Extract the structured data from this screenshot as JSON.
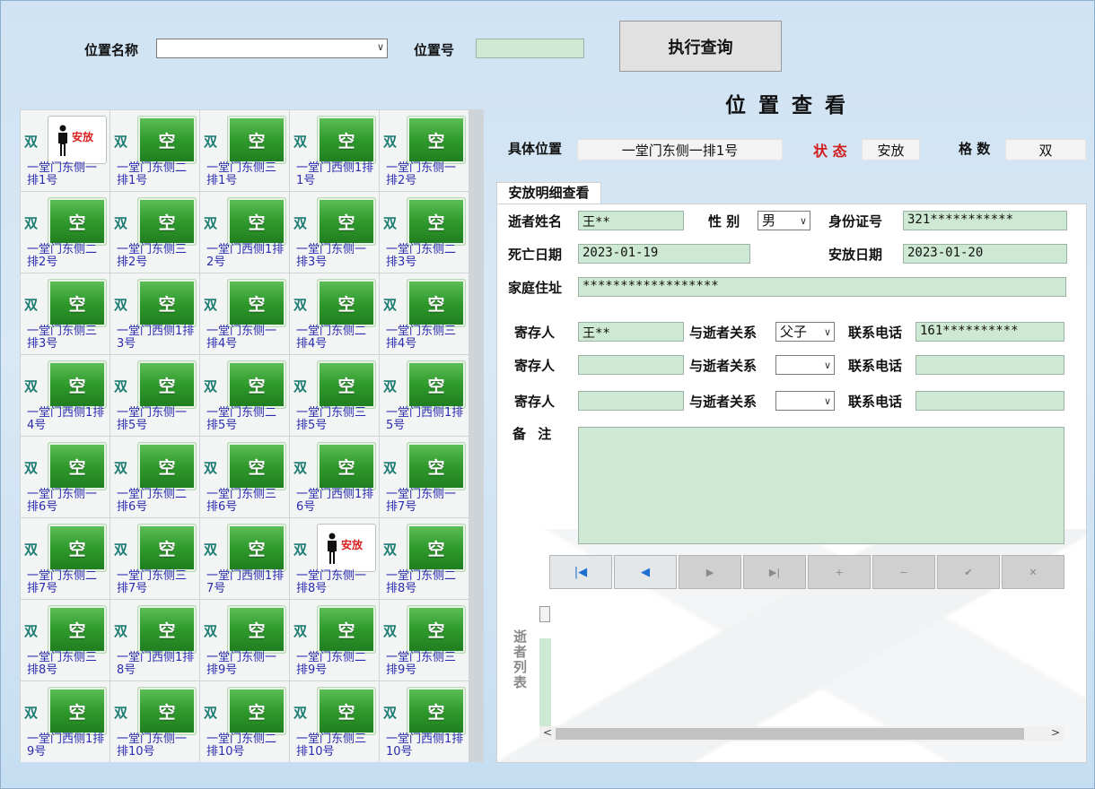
{
  "query": {
    "location_name_label": "位置名称",
    "location_name_value": "",
    "location_no_label": "位置号",
    "location_no_value": "",
    "execute_button": "执行查询"
  },
  "title": "位置查看",
  "detail_header": {
    "location_label": "具体位置",
    "location_value": "一堂门东侧一排1号",
    "status_label": "状 态",
    "status_value": "安放",
    "grid_count_label": "格 数",
    "grid_count_value": "双"
  },
  "tab": {
    "label": "安放明细查看"
  },
  "deceased": {
    "name_label": "逝者姓名",
    "name_value": "王**",
    "gender_label": "性 别",
    "gender_value": "男",
    "id_label": "身份证号",
    "id_value": "321***********",
    "death_label": "死亡日期",
    "death_value": "2023-01-19",
    "placed_label": "安放日期",
    "placed_value": "2023-01-20",
    "address_label": "家庭住址",
    "address_value": "******************"
  },
  "depositors": [
    {
      "label": "寄存人",
      "name": "王**",
      "relation_label": "与逝者关系",
      "relation": "父子",
      "phone_label": "联系电话",
      "phone": "161**********"
    },
    {
      "label": "寄存人",
      "name": "",
      "relation_label": "与逝者关系",
      "relation": "",
      "phone_label": "联系电话",
      "phone": ""
    },
    {
      "label": "寄存人",
      "name": "",
      "relation_label": "与逝者关系",
      "relation": "",
      "phone_label": "联系电话",
      "phone": ""
    }
  ],
  "notes": {
    "label": "备 注",
    "value": ""
  },
  "navigator": [
    "|◀",
    "◀",
    "▶",
    "▶|",
    "+",
    "−",
    "✔",
    "✕"
  ],
  "deceased_list_label": "逝者列表",
  "cells": [
    {
      "type": "双",
      "state": "occupied",
      "state_text": "安放",
      "name": "一堂门东侧一排1号"
    },
    {
      "type": "双",
      "state": "empty",
      "state_text": "空",
      "name": "一堂门东侧二排1号"
    },
    {
      "type": "双",
      "state": "empty",
      "state_text": "空",
      "name": "一堂门东侧三排1号"
    },
    {
      "type": "双",
      "state": "empty",
      "state_text": "空",
      "name": "一堂门西侧1排1号"
    },
    {
      "type": "双",
      "state": "empty",
      "state_text": "空",
      "name": "一堂门东侧一排2号"
    },
    {
      "type": "双",
      "state": "empty",
      "state_text": "空",
      "name": "一堂门东侧二排2号"
    },
    {
      "type": "双",
      "state": "empty",
      "state_text": "空",
      "name": "一堂门东侧三排2号"
    },
    {
      "type": "双",
      "state": "empty",
      "state_text": "空",
      "name": "一堂门西侧1排2号"
    },
    {
      "type": "双",
      "state": "empty",
      "state_text": "空",
      "name": "一堂门东侧一排3号"
    },
    {
      "type": "双",
      "state": "empty",
      "state_text": "空",
      "name": "一堂门东侧二排3号"
    },
    {
      "type": "双",
      "state": "empty",
      "state_text": "空",
      "name": "一堂门东侧三排3号"
    },
    {
      "type": "双",
      "state": "empty",
      "state_text": "空",
      "name": "一堂门西侧1排3号"
    },
    {
      "type": "双",
      "state": "empty",
      "state_text": "空",
      "name": "一堂门东侧一排4号"
    },
    {
      "type": "双",
      "state": "empty",
      "state_text": "空",
      "name": "一堂门东侧二排4号"
    },
    {
      "type": "双",
      "state": "empty",
      "state_text": "空",
      "name": "一堂门东侧三排4号"
    },
    {
      "type": "双",
      "state": "empty",
      "state_text": "空",
      "name": "一堂门西侧1排4号"
    },
    {
      "type": "双",
      "state": "empty",
      "state_text": "空",
      "name": "一堂门东侧一排5号"
    },
    {
      "type": "双",
      "state": "empty",
      "state_text": "空",
      "name": "一堂门东侧二排5号"
    },
    {
      "type": "双",
      "state": "empty",
      "state_text": "空",
      "name": "一堂门东侧三排5号"
    },
    {
      "type": "双",
      "state": "empty",
      "state_text": "空",
      "name": "一堂门西侧1排5号"
    },
    {
      "type": "双",
      "state": "empty",
      "state_text": "空",
      "name": "一堂门东侧一排6号"
    },
    {
      "type": "双",
      "state": "empty",
      "state_text": "空",
      "name": "一堂门东侧二排6号"
    },
    {
      "type": "双",
      "state": "empty",
      "state_text": "空",
      "name": "一堂门东侧三排6号"
    },
    {
      "type": "双",
      "state": "empty",
      "state_text": "空",
      "name": "一堂门西侧1排6号"
    },
    {
      "type": "双",
      "state": "empty",
      "state_text": "空",
      "name": "一堂门东侧一排7号"
    },
    {
      "type": "双",
      "state": "empty",
      "state_text": "空",
      "name": "一堂门东侧二排7号"
    },
    {
      "type": "双",
      "state": "empty",
      "state_text": "空",
      "name": "一堂门东侧三排7号"
    },
    {
      "type": "双",
      "state": "empty",
      "state_text": "空",
      "name": "一堂门西侧1排7号"
    },
    {
      "type": "双",
      "state": "occupied",
      "state_text": "安放",
      "name": "一堂门东侧一排8号"
    },
    {
      "type": "双",
      "state": "empty",
      "state_text": "空",
      "name": "一堂门东侧二排8号"
    },
    {
      "type": "双",
      "state": "empty",
      "state_text": "空",
      "name": "一堂门东侧三排8号"
    },
    {
      "type": "双",
      "state": "empty",
      "state_text": "空",
      "name": "一堂门西侧1排8号"
    },
    {
      "type": "双",
      "state": "empty",
      "state_text": "空",
      "name": "一堂门东侧一排9号"
    },
    {
      "type": "双",
      "state": "empty",
      "state_text": "空",
      "name": "一堂门东侧二排9号"
    },
    {
      "type": "双",
      "state": "empty",
      "state_text": "空",
      "name": "一堂门东侧三排9号"
    },
    {
      "type": "双",
      "state": "empty",
      "state_text": "空",
      "name": "一堂门西侧1排9号"
    },
    {
      "type": "双",
      "state": "empty",
      "state_text": "空",
      "name": "一堂门东侧一排10号"
    },
    {
      "type": "双",
      "state": "empty",
      "state_text": "空",
      "name": "一堂门东侧二排10号"
    },
    {
      "type": "双",
      "state": "empty",
      "state_text": "空",
      "name": "一堂门东侧三排10号"
    },
    {
      "type": "双",
      "state": "empty",
      "state_text": "空",
      "name": "一堂门西侧1排10号"
    }
  ],
  "colors": {
    "empty_tile": "#2f9a2c",
    "status": "#d21b1b",
    "field_green": "#cde8d3",
    "cell_name": "#2a2bb0"
  }
}
